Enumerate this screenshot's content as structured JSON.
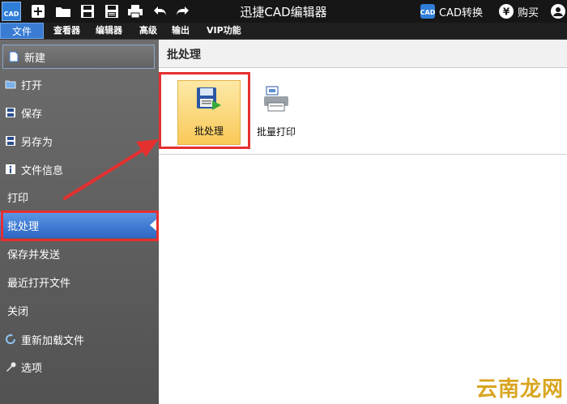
{
  "app": {
    "logo_text": "CAD",
    "title": "迅捷CAD编辑器",
    "cad_convert": "CAD转换",
    "buy": "购买"
  },
  "menu": [
    "文件",
    "查看器",
    "编辑器",
    "高级",
    "输出",
    "VIP功能"
  ],
  "sidebar": {
    "items": [
      {
        "label": "新建",
        "icon": "new-file-icon"
      },
      {
        "label": "打开",
        "icon": "folder-open-icon"
      },
      {
        "label": "保存",
        "icon": "save-icon"
      },
      {
        "label": "另存为",
        "icon": "save-as-icon"
      },
      {
        "label": "文件信息",
        "icon": "file-info-icon"
      },
      {
        "label": "打印",
        "icon": ""
      },
      {
        "label": "批处理",
        "icon": ""
      },
      {
        "label": "保存并发送",
        "icon": ""
      },
      {
        "label": "最近打开文件",
        "icon": ""
      },
      {
        "label": "关闭",
        "icon": ""
      },
      {
        "label": "重新加载文件",
        "icon": "reload-icon"
      },
      {
        "label": "选项",
        "icon": "wrench-icon"
      }
    ]
  },
  "main": {
    "header": "批处理",
    "tools": [
      {
        "label": "批处理",
        "icon": "batch-save-icon",
        "selected": true
      },
      {
        "label": "批量打印",
        "icon": "batch-print-icon",
        "selected": false
      }
    ]
  },
  "watermark": "云南龙网",
  "colors": {
    "accent": "#3a7cd3",
    "highlight": "#f9c959",
    "annotation": "#e53030"
  }
}
